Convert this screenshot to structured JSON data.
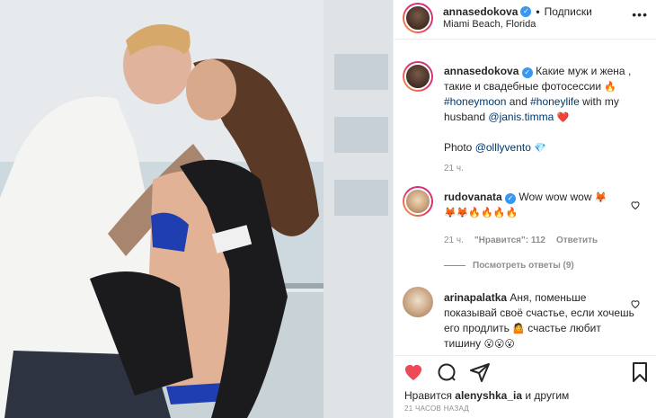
{
  "post": {
    "author": "annasedokova",
    "follow_label": "Подписки",
    "location": "Miami Beach, Florida"
  },
  "caption": {
    "author": "annasedokova",
    "text_1": "Какие муж и жена , такие и свадебные фотосессии",
    "emoji_1": "🔥",
    "hashtag_1": "#honeymoon",
    "and": "and",
    "hashtag_2": "#honeylife",
    "with": "with my husband",
    "mention_1": "@janis.timma",
    "emoji_2": "❤️",
    "photo_label": "Photo",
    "mention_2": "@olllyvento",
    "emoji_3": "💎",
    "time": "21 ч."
  },
  "comments": [
    {
      "author": "rudovanata",
      "text": "Wow wow wow",
      "emoji_a": "🦊",
      "emoji_b": "🦊🦊🔥🔥🔥🔥",
      "time": "21 ч.",
      "likes": "\"Нравится\": 112",
      "reply": "Ответить",
      "show_replies": "Посмотреть ответы (9)"
    },
    {
      "author": "arinapalatka",
      "text": "Аня, поменьше показывай своё счастье, если хочешь его продлить",
      "emoji_a": "🤷",
      "text_2": "счастье любит тишину",
      "emoji_b": "😮😮😮"
    }
  ],
  "footer": {
    "likes_prefix": "Нравится",
    "likes_user": "alenyshka_ia",
    "likes_suffix": "и другим",
    "timestamp": "21 ЧАСОВ НАЗАД"
  },
  "icons": {
    "like": "heart-icon",
    "comment": "comment-icon",
    "share": "share-icon",
    "save": "bookmark-icon",
    "more": "more-icon",
    "verified": "verified-icon"
  },
  "colors": {
    "like_red": "#ed4956",
    "verified_blue": "#3897f0",
    "link": "#00376b",
    "muted": "#8e8e8e"
  }
}
